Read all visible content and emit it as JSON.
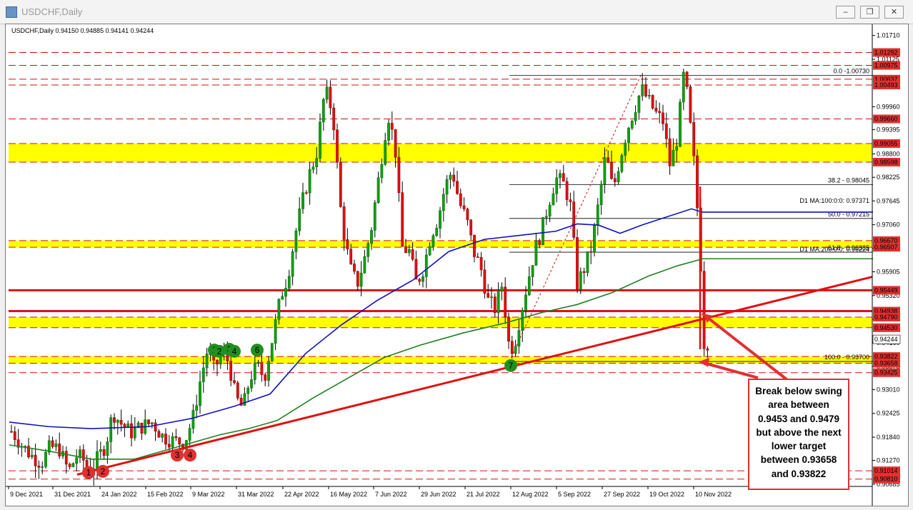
{
  "window": {
    "title": "USDCHF,Daily",
    "controls": [
      "minimize",
      "restore",
      "close"
    ]
  },
  "chart_data": {
    "type": "candlestick",
    "symbol": "USDCHF",
    "timeframe": "Daily",
    "ohlc_label": "USDCHF,Daily  0.94150 0.94885 0.94141 0.94244",
    "last_price": "0.94244",
    "ylim": [
      0.9063,
      1.0195
    ],
    "y_ticks": [
      "1.01710",
      "1.01125",
      "0.99960",
      "0.99395",
      "0.98800",
      "0.98225",
      "0.97645",
      "0.97060",
      "0.96480",
      "0.95905",
      "0.95320",
      "0.94740",
      "0.94160",
      "0.93575",
      "0.93010",
      "0.92425",
      "0.91840",
      "0.91270",
      "0.90685"
    ],
    "x_ticks": [
      "9 Dec 2021",
      "31 Dec 2021",
      "24 Jan 2022",
      "15 Feb 2022",
      "9 Mar 2022",
      "31 Mar 2022",
      "22 Apr 2022",
      "16 May 2022",
      "7 Jun 2022",
      "29 Jun 2022",
      "21 Jul 2022",
      "12 Aug 2022",
      "5 Sep 2022",
      "27 Sep 2022",
      "19 Oct 2022",
      "10 Nov 2022"
    ],
    "price_levels": [
      {
        "value": "1.01292",
        "color": "#d01010",
        "style": "dashed"
      },
      {
        "value": "1.00975",
        "color": "#d01010",
        "style": "dashed"
      },
      {
        "value": "1.00637",
        "color": "#d01010",
        "style": "dashed"
      },
      {
        "value": "1.00493",
        "color": "#d01010",
        "style": "dashed"
      },
      {
        "value": "0.99660",
        "color": "#d01010",
        "style": "dashed"
      },
      {
        "value": "0.99055",
        "color": "#d01010",
        "style": "dashed"
      },
      {
        "value": "0.98598",
        "color": "#d01010",
        "style": "dashed"
      },
      {
        "value": "0.96670",
        "color": "#d01010",
        "style": "dashed"
      },
      {
        "value": "0.96507",
        "color": "#d01010",
        "style": "dashed"
      },
      {
        "value": "0.95449",
        "color": "#e01010",
        "style": "solid"
      },
      {
        "value": "0.94938",
        "color": "#e01010",
        "style": "solid"
      },
      {
        "value": "0.94790",
        "color": "#d01010",
        "style": "dashed"
      },
      {
        "value": "0.94530",
        "color": "#d01010",
        "style": "dashed"
      },
      {
        "value": "0.93822",
        "color": "#d01010",
        "style": "dashed"
      },
      {
        "value": "0.93658",
        "color": "#d01010",
        "style": "dashed"
      },
      {
        "value": "0.93425",
        "color": "#d01010",
        "style": "dashed"
      },
      {
        "value": "0.91014",
        "color": "#d01010",
        "style": "dashed"
      },
      {
        "value": "0.90810",
        "color": "#d01010",
        "style": "dashed"
      }
    ],
    "zones": [
      {
        "from": 0.98598,
        "to": 0.99055,
        "color": "#ffff00"
      },
      {
        "from": 0.96507,
        "to": 0.9667,
        "color": "#ffff00"
      },
      {
        "from": 0.9453,
        "to": 0.9479,
        "color": "#ffff00"
      },
      {
        "from": 0.93658,
        "to": 0.93822,
        "color": "#ffff00"
      }
    ],
    "fibonacci": [
      {
        "label": "0.0 -1.00730",
        "value": 1.0073
      },
      {
        "label": "38.2 - 0.98045",
        "value": 0.98045
      },
      {
        "label": "50.0 - 0.97215",
        "value": 0.97215
      },
      {
        "label": "61.8 - 0.96385",
        "value": 0.96385
      },
      {
        "label": "100.0 - 0.93700",
        "value": 0.937
      }
    ],
    "moving_averages": [
      {
        "label": "D1 MA:100:0:0: 0.97371",
        "color": "#1010c0",
        "last": 0.97371
      },
      {
        "label": "D1 MA:200:0:0: 0.96224",
        "color": "#208020",
        "last": 0.96224
      }
    ],
    "swing_markers": [
      {
        "label": "1",
        "color": "#e03030"
      },
      {
        "label": "2",
        "color": "#e03030"
      },
      {
        "label": "3",
        "color": "#e03030"
      },
      {
        "label": "4",
        "color": "#e03030"
      },
      {
        "label": "1",
        "color": "#209020"
      },
      {
        "label": "2",
        "color": "#209020"
      },
      {
        "label": "3",
        "color": "#209020"
      },
      {
        "label": "4",
        "color": "#209020"
      },
      {
        "label": "6",
        "color": "#209020"
      },
      {
        "label": "7",
        "color": "#209020"
      }
    ],
    "annotation": "Break below swing area between 0.9453 and 0.9479 but above the next lower target between 0.93658 and 0.93822"
  }
}
